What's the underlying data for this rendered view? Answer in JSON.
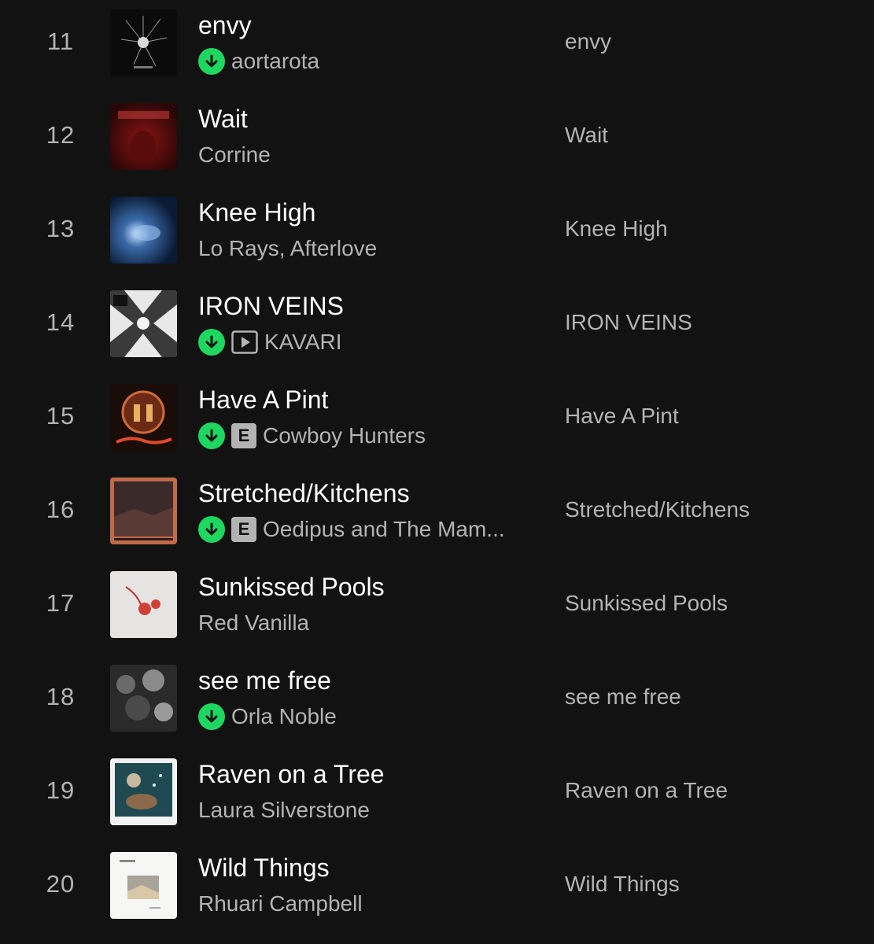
{
  "colors": {
    "background": "#121212",
    "primary_text": "#ffffff",
    "secondary_text": "#b3b3b3",
    "download_accent": "#1ed760"
  },
  "icons": {
    "downloaded": "downloaded-icon",
    "video": "video-icon",
    "explicit": "explicit-badge"
  },
  "tracks": [
    {
      "num": "11",
      "title": "envy",
      "artist": "aortarota",
      "album": "envy",
      "downloaded": true,
      "video": false,
      "explicit": false
    },
    {
      "num": "12",
      "title": "Wait",
      "artist": "Corrine",
      "album": "Wait",
      "downloaded": false,
      "video": false,
      "explicit": false
    },
    {
      "num": "13",
      "title": "Knee High",
      "artist": "Lo Rays, Afterlove",
      "album": "Knee High",
      "downloaded": false,
      "video": false,
      "explicit": false
    },
    {
      "num": "14",
      "title": "IRON VEINS",
      "artist": "KAVARI",
      "album": "IRON VEINS",
      "downloaded": true,
      "video": true,
      "explicit": false
    },
    {
      "num": "15",
      "title": "Have A Pint",
      "artist": "Cowboy Hunters",
      "album": "Have A Pint",
      "downloaded": true,
      "video": false,
      "explicit": true,
      "explicit_label": "E"
    },
    {
      "num": "16",
      "title": "Stretched/Kitchens",
      "artist": "Oedipus and The Mam...",
      "album": "Stretched/Kitchens",
      "downloaded": true,
      "video": false,
      "explicit": true,
      "explicit_label": "E"
    },
    {
      "num": "17",
      "title": "Sunkissed Pools",
      "artist": "Red Vanilla",
      "album": "Sunkissed Pools",
      "downloaded": false,
      "video": false,
      "explicit": false
    },
    {
      "num": "18",
      "title": "see me free",
      "artist": "Orla Noble",
      "album": "see me free",
      "downloaded": true,
      "video": false,
      "explicit": false
    },
    {
      "num": "19",
      "title": "Raven on a Tree",
      "artist": "Laura Silverstone",
      "album": "Raven on a Tree",
      "downloaded": false,
      "video": false,
      "explicit": false
    },
    {
      "num": "20",
      "title": "Wild Things",
      "artist": "Rhuari Campbell",
      "album": "Wild Things",
      "downloaded": false,
      "video": false,
      "explicit": false
    }
  ]
}
